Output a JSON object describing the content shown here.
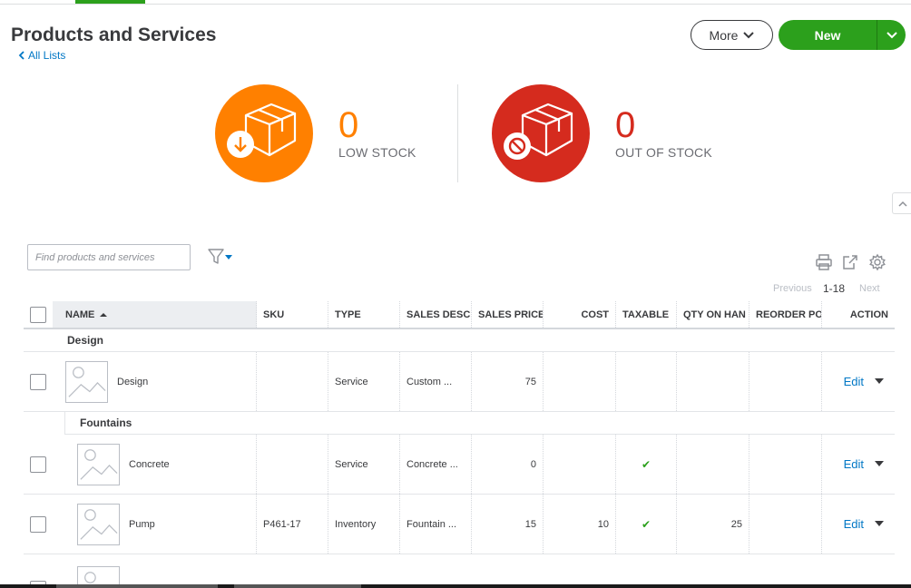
{
  "header": {
    "title": "Products and Services",
    "back_link": "All Lists",
    "more_label": "More",
    "new_label": "New"
  },
  "stock": {
    "low": {
      "count": "0",
      "label": "LOW STOCK",
      "color": "#ff8000"
    },
    "out": {
      "count": "0",
      "label": "OUT OF STOCK",
      "color": "#d52b1e"
    }
  },
  "search": {
    "placeholder": "Find products and services",
    "value": ""
  },
  "pager": {
    "prev": "Previous",
    "range": "1-18",
    "next": "Next"
  },
  "columns": {
    "name": "NAME",
    "sku": "SKU",
    "type": "TYPE",
    "sales_desc": "SALES DESCR",
    "sales_price": "SALES PRICE",
    "cost": "COST",
    "taxable": "TAXABLE",
    "qty": "QTY ON HAN",
    "reorder": "REORDER PO",
    "action": "ACTION"
  },
  "groups": [
    {
      "name": "Design",
      "rows": [
        {
          "name": "Design",
          "sku": "",
          "type": "Service",
          "sales_desc": "Custom ...",
          "sales_price": "75",
          "cost": "",
          "taxable": "",
          "qty": "",
          "reorder": "",
          "action": "Edit"
        }
      ]
    },
    {
      "name": "Fountains",
      "rows": [
        {
          "name": "Concrete",
          "sku": "",
          "type": "Service",
          "sales_desc": "Concrete ...",
          "sales_price": "0",
          "cost": "",
          "taxable": "✔",
          "qty": "",
          "reorder": "",
          "action": "Edit"
        },
        {
          "name": "Pump",
          "sku": "P461-17",
          "type": "Inventory",
          "sales_desc": "Fountain ...",
          "sales_price": "15",
          "cost": "10",
          "taxable": "✔",
          "qty": "25",
          "reorder": "",
          "action": "Edit"
        }
      ]
    }
  ],
  "colors": {
    "brand_green": "#2ca01c",
    "link_blue": "#0077c5",
    "text": "#393a3d"
  }
}
